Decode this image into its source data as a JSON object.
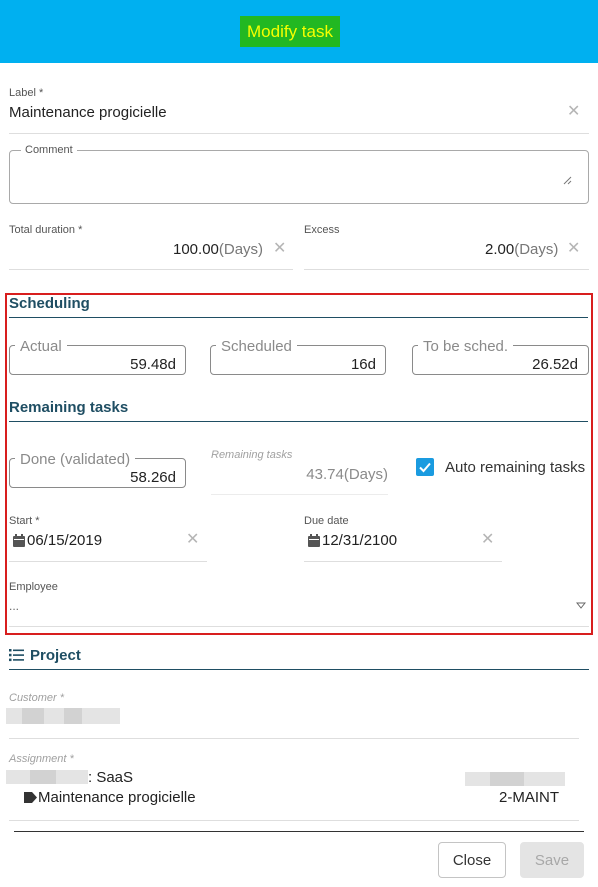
{
  "header": {
    "title": "Modify task",
    "bg_color": "#00b0f0",
    "title_bg_color": "#22b822",
    "title_color": "#f6ff00"
  },
  "label_field": {
    "label": "Label *",
    "value": "Maintenance progicielle",
    "clear_icon": "close-icon"
  },
  "comment_field": {
    "label": "Comment",
    "value": ""
  },
  "total_duration": {
    "label": "Total duration *",
    "value": "100.00",
    "unit": "(Days)"
  },
  "excess": {
    "label": "Excess",
    "value": "2.00",
    "unit": "(Days)"
  },
  "scheduling": {
    "title": "Scheduling",
    "actual": {
      "label": "Actual",
      "value": "59.48d"
    },
    "scheduled": {
      "label": "Scheduled",
      "value": "16d"
    },
    "to_be_scheduled": {
      "label": "To be sched.",
      "value": "26.52d"
    }
  },
  "remaining": {
    "title": "Remaining tasks",
    "done": {
      "label": "Done (validated)",
      "value": "58.26d"
    },
    "remaining_tasks": {
      "label": "Remaining tasks",
      "value": "43.74",
      "unit": "(Days)"
    },
    "auto_remaining": {
      "label": "Auto remaining tasks",
      "checked": true
    }
  },
  "start": {
    "label": "Start *",
    "value": "06/15/2019"
  },
  "due_date": {
    "label": "Due date",
    "value": "12/31/2100"
  },
  "employee": {
    "label": "Employee",
    "value": "..."
  },
  "project": {
    "title": "Project",
    "customer_label": "Customer *",
    "assignment_label": "Assignment *",
    "assignment_suffix": ": SaaS",
    "task_name": "Maintenance progicielle",
    "task_code": "2-MAINT"
  },
  "buttons": {
    "close": "Close",
    "save": "Save"
  },
  "colors": {
    "frame": "#d81e1e",
    "section": "#1f4e63",
    "checkbox": "#1a9be0"
  }
}
